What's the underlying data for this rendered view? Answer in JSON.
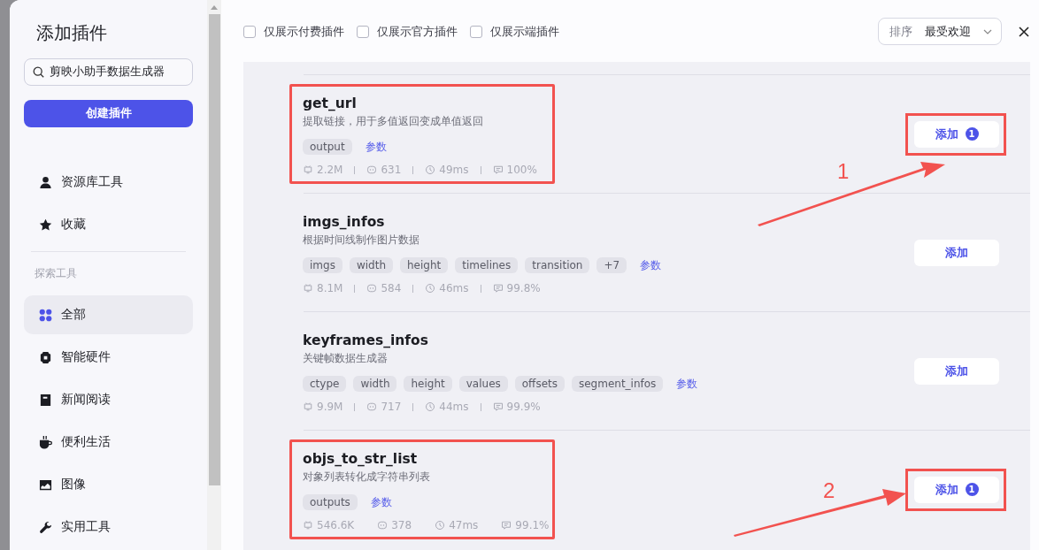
{
  "sidebar": {
    "title": "添加插件",
    "search": {
      "value": "剪映小助手数据生成器"
    },
    "create_button": "创建插件",
    "items": [
      {
        "label": "资源库工具",
        "selected": false
      },
      {
        "label": "收藏",
        "selected": false
      }
    ],
    "section_title": "探索工具",
    "categories": [
      {
        "label": "全部",
        "selected": true
      },
      {
        "label": "智能硬件",
        "selected": false
      },
      {
        "label": "新闻阅读",
        "selected": false
      },
      {
        "label": "便利生活",
        "selected": false
      },
      {
        "label": "图像",
        "selected": false
      },
      {
        "label": "实用工具",
        "selected": false
      }
    ]
  },
  "filters": [
    {
      "label": "仅展示付费插件",
      "checked": false
    },
    {
      "label": "仅展示官方插件",
      "checked": false
    },
    {
      "label": "仅展示端插件",
      "checked": false
    }
  ],
  "sort": {
    "label": "排序",
    "value": "最受欢迎"
  },
  "plugins": [
    {
      "name": "get_url",
      "description": "提取链接，用于多值返回变成单值返回",
      "tags": [
        "output"
      ],
      "params_link": "参数",
      "stats": [
        "2.2M",
        "631",
        "49ms",
        "100%"
      ],
      "add_button": "添加",
      "badge": "1",
      "highlighted": true
    },
    {
      "name": "imgs_infos",
      "description": "根据时间线制作图片数据",
      "tags": [
        "imgs",
        "width",
        "height",
        "timelines",
        "transition",
        "+7"
      ],
      "params_link": "参数",
      "stats": [
        "8.1M",
        "584",
        "46ms",
        "99.8%"
      ],
      "add_button": "添加",
      "highlighted": false
    },
    {
      "name": "keyframes_infos",
      "description": "关键帧数据生成器",
      "tags": [
        "ctype",
        "width",
        "height",
        "values",
        "offsets",
        "segment_infos"
      ],
      "params_link": "参数",
      "stats": [
        "9.9M",
        "717",
        "44ms",
        "99.9%"
      ],
      "add_button": "添加",
      "highlighted": false
    },
    {
      "name": "objs_to_str_list",
      "description": "对象列表转化成字符串列表",
      "tags": [
        "outputs"
      ],
      "params_link": "参数",
      "stats": [
        "546.6K",
        "378",
        "47ms",
        "99.1%"
      ],
      "add_button": "添加",
      "badge": "1",
      "highlighted": true
    }
  ],
  "annotations": [
    {
      "label": "1"
    },
    {
      "label": "2"
    }
  ]
}
